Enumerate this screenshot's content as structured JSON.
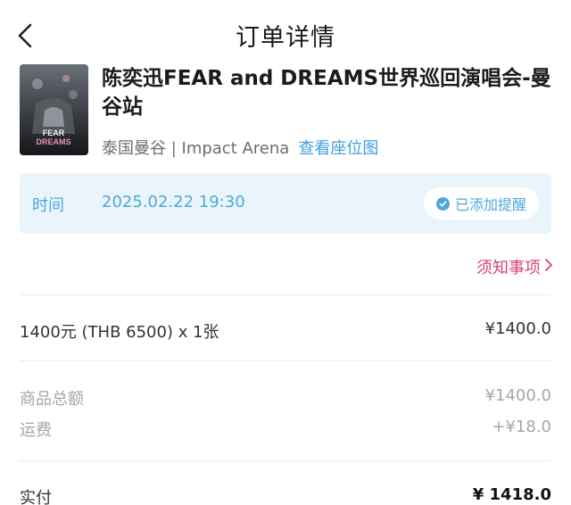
{
  "header": {
    "title": "订单详情"
  },
  "event": {
    "name": "陈奕迅FEAR and DREAMS世界巡回演唱会-曼谷站",
    "venue": "泰国曼谷 | Impact Arena",
    "seat_map_link": "查看座位图",
    "poster_text": "FEAR DREAMS"
  },
  "schedule": {
    "label": "时间",
    "datetime": "2025.02.22 19:30",
    "reminder": "已添加提醒"
  },
  "notice_link": "须知事项",
  "ticket": {
    "description": "1400元 (THB 6500) x 1张",
    "price": "¥1400.0"
  },
  "summary": [
    {
      "label": "商品总额",
      "value": "¥1400.0"
    },
    {
      "label": "运费",
      "value": "+¥18.0"
    }
  ],
  "total": {
    "label": "实付",
    "value": "¥ 1418.0"
  },
  "colors": {
    "accent_blue": "#4fa8d8",
    "notice_pink": "#d6457a",
    "time_bg": "#e9f5fb"
  }
}
